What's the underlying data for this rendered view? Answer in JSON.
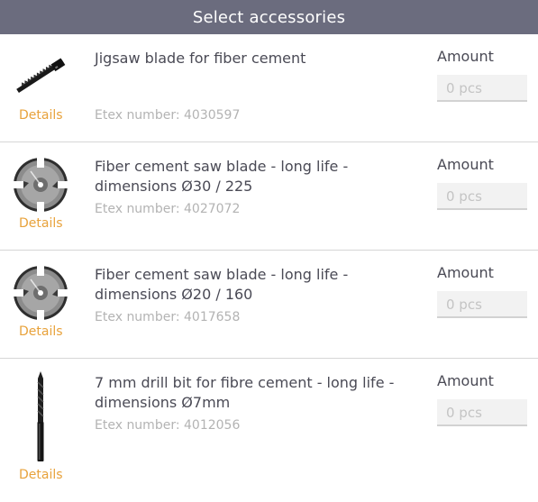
{
  "header": {
    "title": "Select accessories"
  },
  "items": [
    {
      "title": "Jigsaw blade for fiber cement",
      "etex": "Etex number: 4030597",
      "details": "Details",
      "amount_label": "Amount",
      "amount_placeholder": "0 pcs",
      "icon": "jigsaw-blade-icon"
    },
    {
      "title": "Fiber cement saw blade - long life - dimensions Ø30 / 225",
      "etex": "Etex number: 4027072",
      "details": "Details",
      "amount_label": "Amount",
      "amount_placeholder": "0 pcs",
      "icon": "saw-blade-icon"
    },
    {
      "title": "Fiber cement saw blade - long life - dimensions Ø20 / 160",
      "etex": "Etex number: 4017658",
      "details": "Details",
      "amount_label": "Amount",
      "amount_placeholder": "0 pcs",
      "icon": "saw-blade-icon"
    },
    {
      "title": "7 mm drill bit for fibre cement - long life - dimensions Ø7mm",
      "etex": "Etex number: 4012056",
      "details": "Details",
      "amount_label": "Amount",
      "amount_placeholder": "0 pcs",
      "icon": "drill-bit-icon"
    }
  ],
  "colors": {
    "header_bg": "#6b6c7e",
    "details_link": "#e8a23b",
    "etex_text": "#b3b3b3"
  }
}
